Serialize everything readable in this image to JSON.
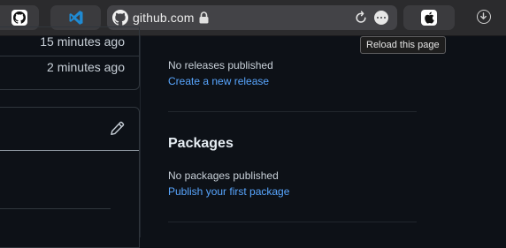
{
  "browser": {
    "url": "github.com",
    "tooltip": "Reload this page",
    "tabs": [
      {
        "icon": "github-icon"
      },
      {
        "icon": "vscode-icon"
      },
      {
        "icon": "apple-icon"
      }
    ]
  },
  "left": {
    "times": [
      "15 minutes ago",
      "2 minutes ago"
    ]
  },
  "releases": {
    "empty_text": "No releases published",
    "link": "Create a new release"
  },
  "packages": {
    "title": "Packages",
    "empty_text": "No packages published",
    "link": "Publish your first package"
  },
  "colors": {
    "background": "#0d1117",
    "link": "#58a6ff",
    "border": "#30363d",
    "toolbar": "#2b2b2d"
  }
}
